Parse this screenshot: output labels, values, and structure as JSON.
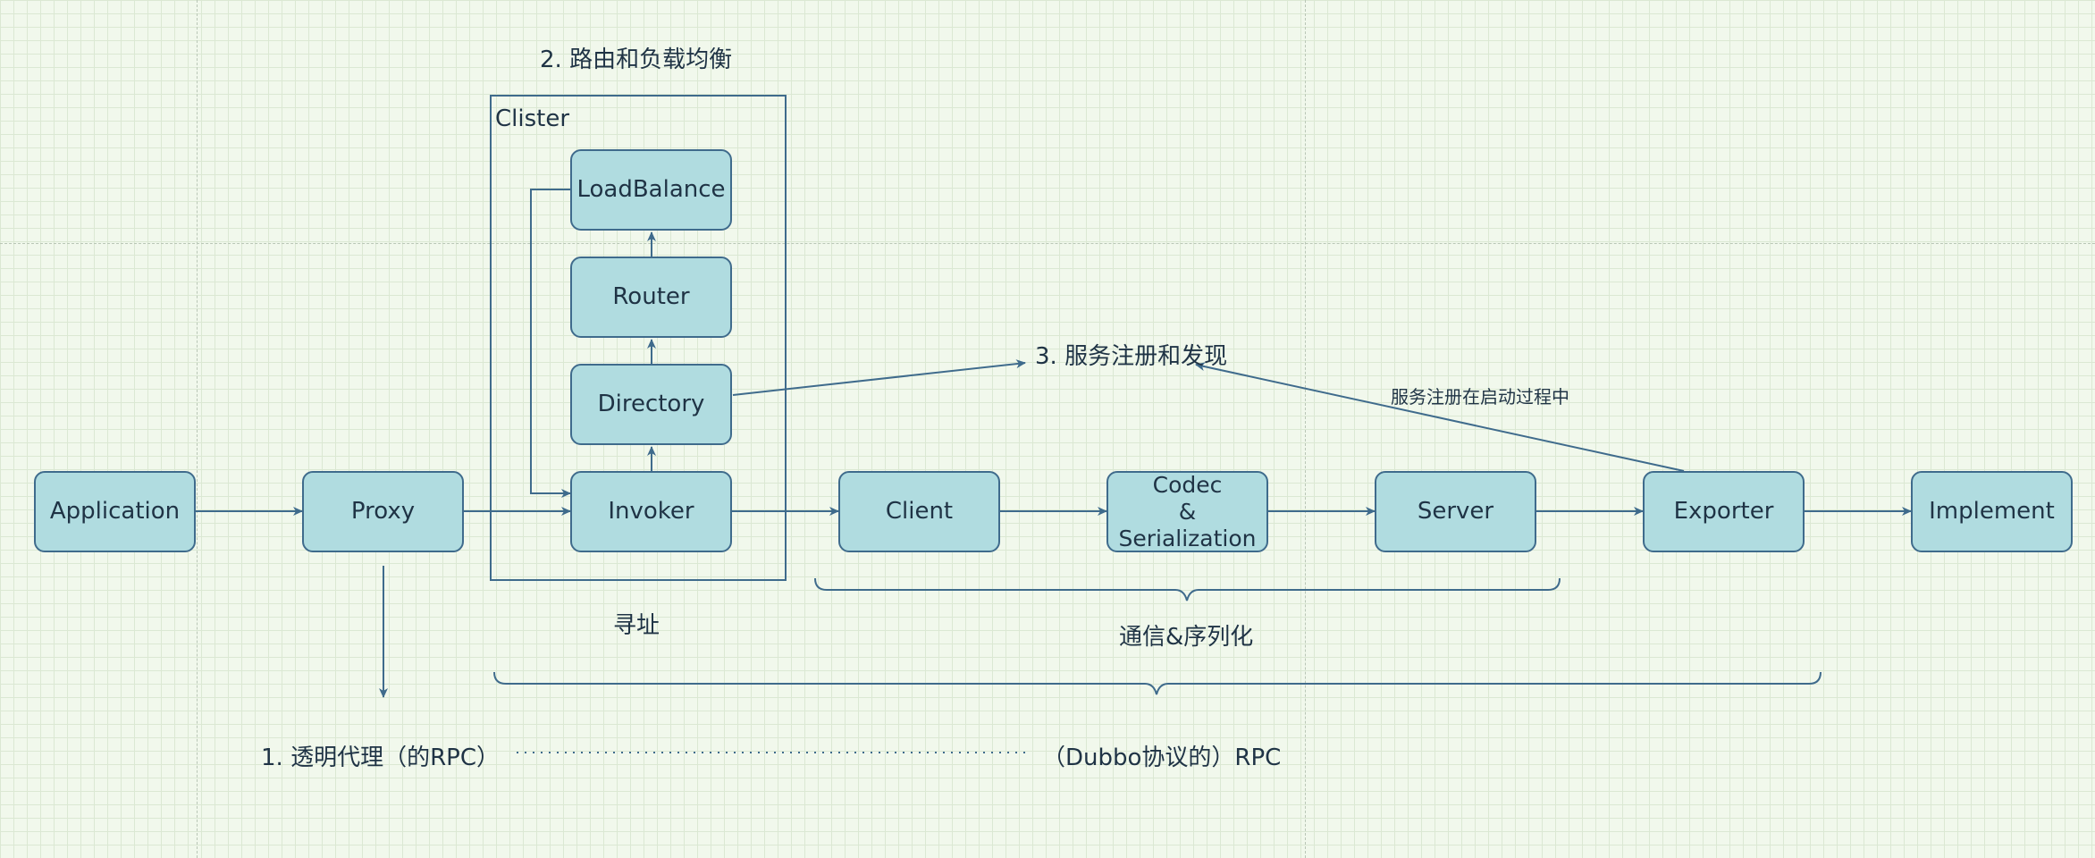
{
  "cluster": {
    "label": "Clister"
  },
  "nodes": {
    "application": "Application",
    "proxy": "Proxy",
    "invoker": "Invoker",
    "directory": "Directory",
    "router": "Router",
    "loadbalance": "LoadBalance",
    "client": "Client",
    "codec": "Codec\n&\nSerialization",
    "server": "Server",
    "exporter": "Exporter",
    "implement": "Implement"
  },
  "labels": {
    "routing": "2. 路由和负载均衡",
    "registry": "3. 服务注册和发现",
    "register_on_start": "服务注册在启动过程中",
    "addressing": "寻址",
    "comm_serial": "通信&序列化",
    "transparent_proxy": "1. 透明代理（的RPC）",
    "dubbo_rpc": "（Dubbo协议的）RPC"
  }
}
